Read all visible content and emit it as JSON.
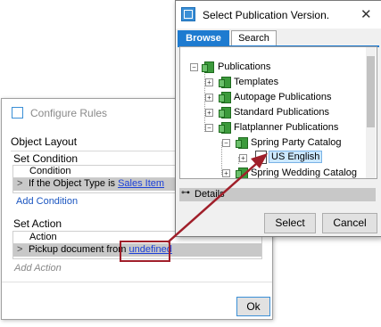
{
  "configure_rules": {
    "title": "Configure Rules",
    "object_layout_label": "Object Layout",
    "set_condition_label": "Set Condition",
    "condition_column": "Condition",
    "condition_row_prefix": "If the Object Type is",
    "condition_row_link": "Sales Item",
    "add_condition": "Add Condition",
    "set_action_label": "Set Action",
    "action_column": "Action",
    "action_row_prefix": "Pickup document from",
    "action_row_link": "undefined",
    "add_action": "Add Action",
    "ok_label": "Ok"
  },
  "select_publication": {
    "title": "Select Publication Version.",
    "close_glyph": "✕",
    "tabs": [
      "Browse",
      "Search"
    ],
    "tree": {
      "root": "Publications",
      "children": [
        "Templates",
        "Autopage Publications",
        "Standard Publications",
        "Flatplanner Publications"
      ],
      "flatplanner_children": [
        "Spring Party Catalog",
        "Spring Wedding Catalog"
      ],
      "version": "US English"
    },
    "details_label": "Details",
    "select_label": "Select",
    "cancel_label": "Cancel"
  },
  "colors": {
    "accent": "#1e7bd0",
    "callout": "#a01f2a",
    "link": "#1a3fd8"
  }
}
